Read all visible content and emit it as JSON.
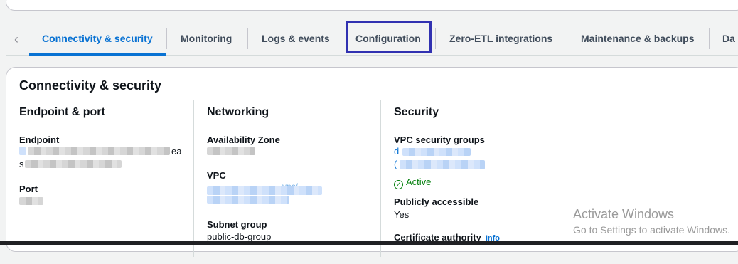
{
  "tabs": [
    {
      "label": "Connectivity & security"
    },
    {
      "label": "Monitoring"
    },
    {
      "label": "Logs & events"
    },
    {
      "label": "Configuration"
    },
    {
      "label": "Zero-ETL integrations"
    },
    {
      "label": "Maintenance & backups"
    },
    {
      "label": "Da"
    }
  ],
  "active_tab": "Connectivity & security",
  "section": {
    "title": "Connectivity & security",
    "endpoint_port": {
      "heading": "Endpoint & port",
      "endpoint_label": "Endpoint",
      "endpoint_value_tail": "ea",
      "endpoint_value_line2_start": "s",
      "port_label": "Port",
      "port_value": "3306"
    },
    "networking": {
      "heading": "Networking",
      "az_label": "Availability Zone",
      "vpc_label": "VPC",
      "vpc_value_partial": "...vpc/...",
      "subnet_label": "Subnet group",
      "subnet_value": "public-db-group"
    },
    "security": {
      "heading": "Security",
      "sg_label": "VPC security groups",
      "sg_link1_start": "d",
      "sg_link2_start": "(",
      "sg_status": "Active",
      "public_label": "Publicly accessible",
      "public_value": "Yes",
      "cert_label": "Certificate authority",
      "cert_info": "Info"
    }
  },
  "watermark": {
    "line1": "Activate Windows",
    "line2": "Go to Settings to activate Windows."
  },
  "colors": {
    "accent": "#0972d3",
    "focus_outline": "#3131b1",
    "success": "#037f0c"
  }
}
